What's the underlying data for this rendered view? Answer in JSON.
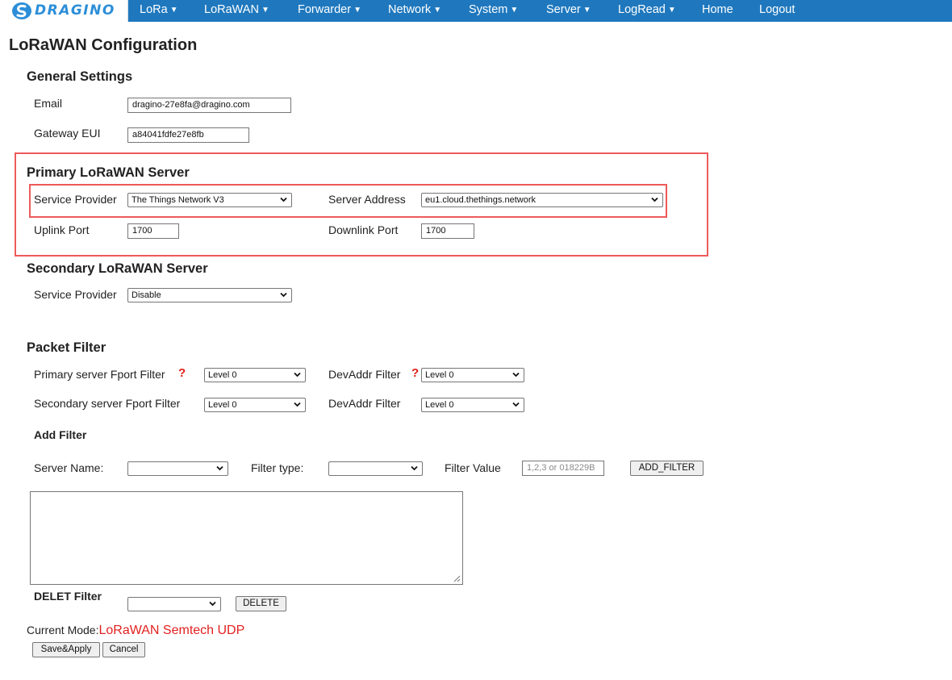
{
  "nav": {
    "logo_text": "DRAGINO",
    "items": [
      {
        "label": "LoRa",
        "has_dropdown": true
      },
      {
        "label": "LoRaWAN",
        "has_dropdown": true
      },
      {
        "label": "Forwarder",
        "has_dropdown": true
      },
      {
        "label": "Network",
        "has_dropdown": true
      },
      {
        "label": "System",
        "has_dropdown": true
      },
      {
        "label": "Server",
        "has_dropdown": true
      },
      {
        "label": "LogRead",
        "has_dropdown": true
      },
      {
        "label": "Home",
        "has_dropdown": false
      },
      {
        "label": "Logout",
        "has_dropdown": false
      }
    ],
    "caret": "▼"
  },
  "page_title": "LoRaWAN Configuration",
  "general": {
    "title": "General Settings",
    "email_label": "Email",
    "email_value": "dragino-27e8fa@dragino.com",
    "eui_label": "Gateway EUI",
    "eui_value": "a84041fdfe27e8fb"
  },
  "primary": {
    "title": "Primary LoRaWAN Server",
    "provider_label": "Service Provider",
    "provider_value": "The Things Network V3",
    "address_label": "Server Address",
    "address_value": "eu1.cloud.thethings.network",
    "uplink_label": "Uplink Port",
    "uplink_value": "1700",
    "downlink_label": "Downlink Port",
    "downlink_value": "1700"
  },
  "secondary": {
    "title": "Secondary LoRaWAN Server",
    "provider_label": "Service Provider",
    "provider_value": "Disable"
  },
  "packet_filter": {
    "title": "Packet Filter",
    "primary_fport_label": "Primary server Fport Filter",
    "primary_fport_value": "Level 0",
    "primary_devaddr_label": "DevAddr Filter",
    "primary_devaddr_value": "Level 0",
    "secondary_fport_label": "Secondary server Fport Filter",
    "secondary_fport_value": "Level 0",
    "secondary_devaddr_label": "DevAddr Filter",
    "secondary_devaddr_value": "Level 0",
    "help_mark": "?"
  },
  "add_filter": {
    "title": "Add Filter",
    "server_name_label": "Server Name:",
    "server_name_value": "",
    "filter_type_label": "Filter type:",
    "filter_type_value": "",
    "filter_value_label": "Filter Value",
    "filter_value_placeholder": "1,2,3 or 018229B",
    "add_button": "ADD_FILTER"
  },
  "delete_filter": {
    "title": "DELET Filter",
    "select_value": "",
    "delete_button": "DELETE"
  },
  "mode": {
    "label": "Current Mode:",
    "value": "LoRaWAN Semtech UDP"
  },
  "actions": {
    "save": "Save&Apply",
    "cancel": "Cancel"
  },
  "colors": {
    "nav_bg": "#1f78be",
    "highlight_box": "#ee5a5a",
    "help_mark": "#e0201a",
    "mode_value": "#e32020"
  }
}
